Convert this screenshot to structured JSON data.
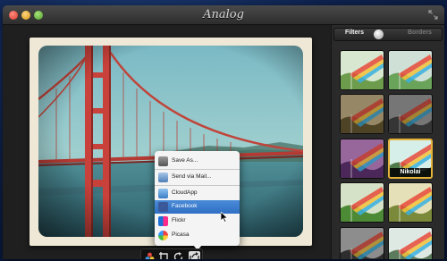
{
  "app": {
    "title": "Analog"
  },
  "sidebar": {
    "tabs": [
      {
        "label": "Filters"
      },
      {
        "label": "Borders"
      }
    ],
    "selected_tab": "Filters",
    "selected_filter_name": "Nikolai"
  },
  "share_menu": {
    "items": [
      {
        "label": "Save As...",
        "icon": "save-icon"
      },
      {
        "label": "Send via Mail...",
        "icon": "mail-icon"
      },
      {
        "label": "CloudApp",
        "icon": "cloudapp-icon"
      },
      {
        "label": "Facebook",
        "icon": "facebook-icon"
      },
      {
        "label": "Flickr",
        "icon": "flickr-icon"
      },
      {
        "label": "Picasa",
        "icon": "picasa-icon"
      }
    ],
    "highlighted_item": "Facebook"
  },
  "toolbar": {
    "buttons": [
      {
        "icon": "color-wheel-icon"
      },
      {
        "icon": "crop-icon"
      },
      {
        "icon": "rotate-icon"
      },
      {
        "icon": "share-icon"
      }
    ]
  },
  "colors": {
    "accent_selected_border": "#e5b23a",
    "menu_highlight": "#3b7fd1"
  }
}
